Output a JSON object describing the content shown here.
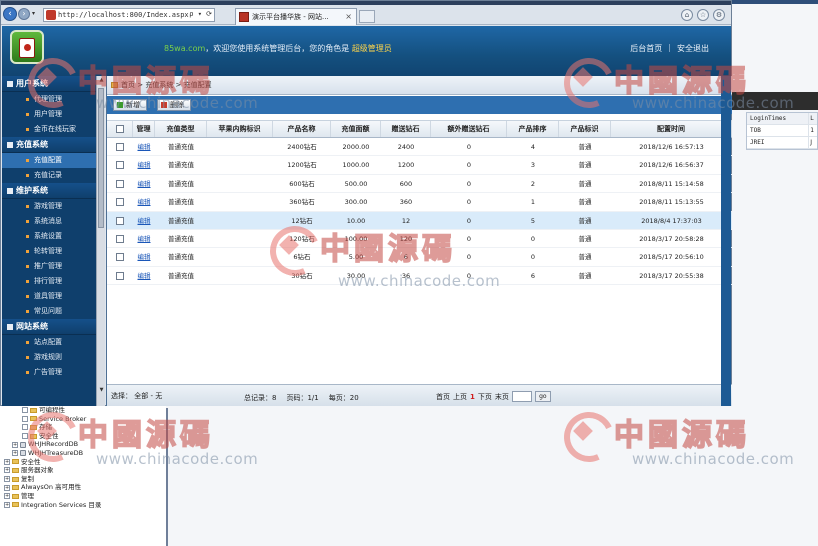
{
  "browser": {
    "url": "http://localhost:800/Index.aspx",
    "tab_title": "演示平台播华族 - 网站...",
    "tab_close": "×",
    "url_btns": "ρ ▾ ⟳"
  },
  "header": {
    "welcome_site": "85wa.com",
    "welcome_text": "，欢迎您使用系统管理后台，您的角色是",
    "welcome_role": "超级管理员",
    "link_home": "后台首页",
    "link_sep": "|",
    "link_logout": "安全退出"
  },
  "sidebar": {
    "groups": [
      {
        "label": "用户系统",
        "items": [
          "代理管理",
          "用户管理",
          "金币在线玩家"
        ]
      },
      {
        "label": "充值系统",
        "items": [
          "充值配置",
          "充值记录"
        ]
      },
      {
        "label": "维护系统",
        "items": [
          "游戏管理",
          "系统消息",
          "系统设置",
          "轮转管理",
          "推广管理",
          "排行管理",
          "道具管理",
          "常见问题"
        ]
      },
      {
        "label": "网站系统",
        "items": [
          "站点配置",
          "游戏规则",
          "广告管理"
        ]
      }
    ]
  },
  "breadcrumb": "首页 > 充值系统 > 充值配置",
  "toolbar": {
    "add": "新增",
    "delete": "删除"
  },
  "grid": {
    "headers": [
      "",
      "管理",
      "充值类型",
      "苹果内购标识",
      "产品名称",
      "充值面额",
      "赠送钻石",
      "额外赠送钻石",
      "产品排序",
      "产品标识",
      "配置时间"
    ],
    "rows": [
      {
        "action": "编辑",
        "type": "普通充值",
        "iap": "",
        "name": "2400钻石",
        "amount": "2000.00",
        "gift": "2400",
        "extra": "0",
        "sort": "4",
        "flag": "普通",
        "time": "2018/12/6 16:57:13"
      },
      {
        "action": "编辑",
        "type": "普通充值",
        "iap": "",
        "name": "1200钻石",
        "amount": "1000.00",
        "gift": "1200",
        "extra": "0",
        "sort": "3",
        "flag": "普通",
        "time": "2018/12/6 16:56:37"
      },
      {
        "action": "编辑",
        "type": "普通充值",
        "iap": "",
        "name": "600钻石",
        "amount": "500.00",
        "gift": "600",
        "extra": "0",
        "sort": "2",
        "flag": "普通",
        "time": "2018/8/11 15:14:58"
      },
      {
        "action": "编辑",
        "type": "普通充值",
        "iap": "",
        "name": "360钻石",
        "amount": "300.00",
        "gift": "360",
        "extra": "0",
        "sort": "1",
        "flag": "普通",
        "time": "2018/8/11 15:13:55"
      },
      {
        "action": "编辑",
        "type": "普通充值",
        "iap": "",
        "name": "12钻石",
        "amount": "10.00",
        "gift": "12",
        "extra": "0",
        "sort": "5",
        "flag": "普通",
        "time": "2018/8/4 17:37:03"
      },
      {
        "action": "编辑",
        "type": "普通充值",
        "iap": "",
        "name": "120钻石",
        "amount": "100.00",
        "gift": "120",
        "extra": "0",
        "sort": "0",
        "flag": "普通",
        "time": "2018/3/17 20:58:28"
      },
      {
        "action": "编辑",
        "type": "普通充值",
        "iap": "",
        "name": "6钻石",
        "amount": "5.00",
        "gift": "6",
        "extra": "0",
        "sort": "0",
        "flag": "普通",
        "time": "2018/5/17 20:56:10"
      },
      {
        "action": "编辑",
        "type": "普通充值",
        "iap": "",
        "name": "30钻石",
        "amount": "30.00",
        "gift": "36",
        "extra": "0",
        "sort": "6",
        "flag": "普通",
        "time": "2018/3/17 20:55:38"
      }
    ]
  },
  "pager": {
    "select_label": "选择：",
    "select_all": "全部",
    "select_sep": "-",
    "select_none": "无",
    "total": "总记录：8",
    "page": "页码：1/1",
    "per_page": "每页：20",
    "first": "首页",
    "prev": "上页",
    "current": "1",
    "next": "下页",
    "last": "末页",
    "go": "go"
  },
  "bg_grid": {
    "header": [
      "LoginTimes",
      "L"
    ],
    "rows": [
      [
        "TOB",
        "1"
      ],
      [
        "JREI",
        "J"
      ]
    ]
  },
  "bg_tree": [
    {
      "exp": "",
      "icon": "fold",
      "label": "可编程性",
      "indent": 18
    },
    {
      "exp": "",
      "icon": "fold",
      "label": "Service Broker",
      "indent": 18
    },
    {
      "exp": "",
      "icon": "fold",
      "label": "存储",
      "indent": 18
    },
    {
      "exp": "",
      "icon": "fold",
      "label": "安全性",
      "indent": 18
    },
    {
      "exp": "+",
      "icon": "db",
      "label": "WHJHRecordDB",
      "indent": 8
    },
    {
      "exp": "+",
      "icon": "db",
      "label": "WHJHTreasureDB",
      "indent": 8
    },
    {
      "exp": "+",
      "icon": "fold",
      "label": "安全性",
      "indent": 0
    },
    {
      "exp": "+",
      "icon": "fold",
      "label": "服务器对象",
      "indent": 0
    },
    {
      "exp": "+",
      "icon": "fold",
      "label": "复制",
      "indent": 0
    },
    {
      "exp": "+",
      "icon": "fold",
      "label": "AlwaysOn 高可用性",
      "indent": 0
    },
    {
      "exp": "+",
      "icon": "fold",
      "label": "管理",
      "indent": 0
    },
    {
      "exp": "+",
      "icon": "fold",
      "label": "Integration Services 目录",
      "indent": 0
    }
  ],
  "watermark": {
    "cn": "中國源碼",
    "en": "www.chinacode.com"
  },
  "colors": {
    "header_bg": "#14507f",
    "sidebar_bg": "#0f3f6c",
    "role": "#ffd54a",
    "site": "#7cd24a",
    "highlight_row": "#d9ebfa",
    "edit_link": "#1a56b8"
  }
}
